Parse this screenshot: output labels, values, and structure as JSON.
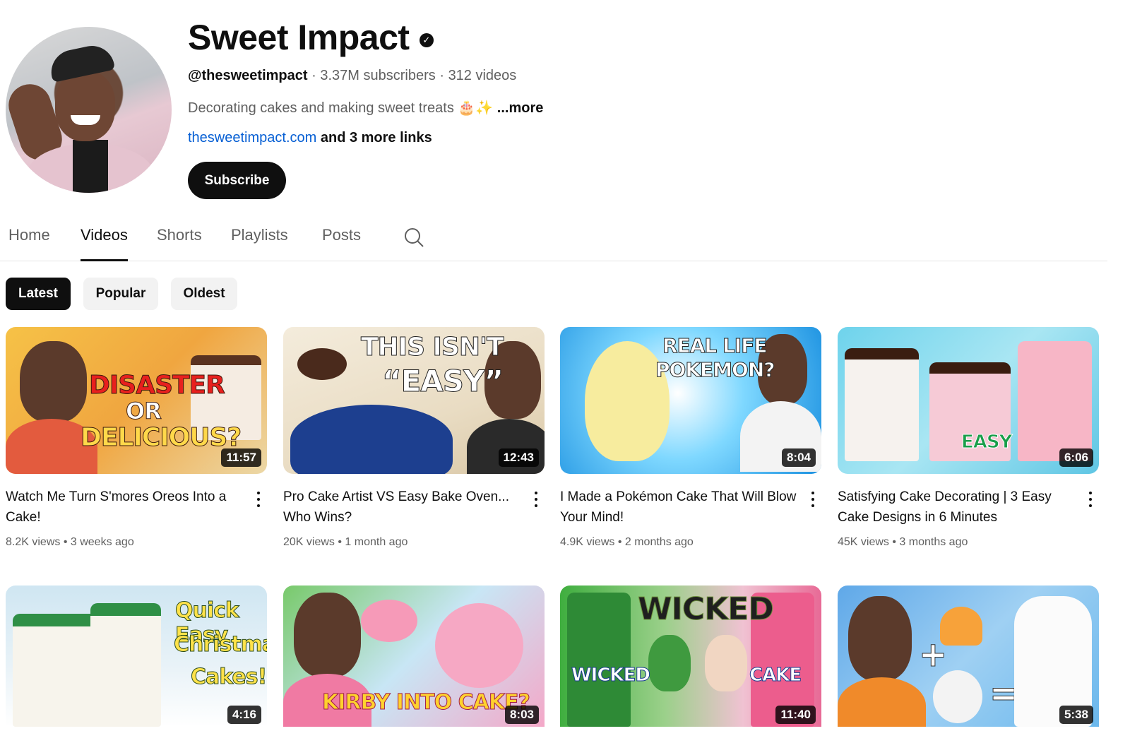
{
  "channel": {
    "name": "Sweet Impact",
    "handle": "@thesweetimpact",
    "subscribers": "3.37M subscribers",
    "video_count": "312 videos",
    "separator": "·",
    "description": "Decorating cakes and making sweet treats 🎂✨",
    "more": "...more",
    "link": "thesweetimpact.com",
    "more_links": "and 3 more links",
    "subscribe_label": "Subscribe"
  },
  "tabs": [
    "Home",
    "Videos",
    "Shorts",
    "Playlists",
    "Posts"
  ],
  "active_tab": "Videos",
  "chips": [
    "Latest",
    "Popular",
    "Oldest"
  ],
  "active_chip": "Latest",
  "videos": [
    {
      "title": "Watch Me Turn S'mores Oreos Into a Cake!",
      "views": "8.2K views",
      "age": "3 weeks ago",
      "duration": "11:57",
      "thumb_text": [
        "DISASTER",
        "OR",
        "DELICIOUS?"
      ]
    },
    {
      "title": "Pro Cake Artist VS Easy Bake Oven... Who Wins?",
      "views": "20K views",
      "age": "1 month ago",
      "duration": "12:43",
      "thumb_text": [
        "THIS ISN'T",
        "“EASY”"
      ]
    },
    {
      "title": "I Made a Pokémon Cake That Will Blow Your Mind!",
      "views": "4.9K views",
      "age": "2 months ago",
      "duration": "8:04",
      "thumb_text": [
        "REAL LIFE",
        "POKEMON?"
      ]
    },
    {
      "title": "Satisfying Cake Decorating | 3 Easy Cake Designs in 6 Minutes",
      "views": "45K views",
      "age": "3 months ago",
      "duration": "6:06",
      "thumb_text": [
        "EASY"
      ]
    },
    {
      "title": "",
      "views": "",
      "age": "",
      "duration": "4:16",
      "thumb_text": [
        "Quick Easy",
        "Christmas",
        "Cakes!"
      ]
    },
    {
      "title": "",
      "views": "",
      "age": "",
      "duration": "8:03",
      "thumb_text": [
        "KIRBY INTO CAKE?"
      ]
    },
    {
      "title": "",
      "views": "",
      "age": "",
      "duration": "11:40",
      "thumb_text": [
        "WICKED",
        "WICKED",
        "CAKE"
      ]
    },
    {
      "title": "",
      "views": "",
      "age": "",
      "duration": "5:38",
      "thumb_text": []
    }
  ]
}
